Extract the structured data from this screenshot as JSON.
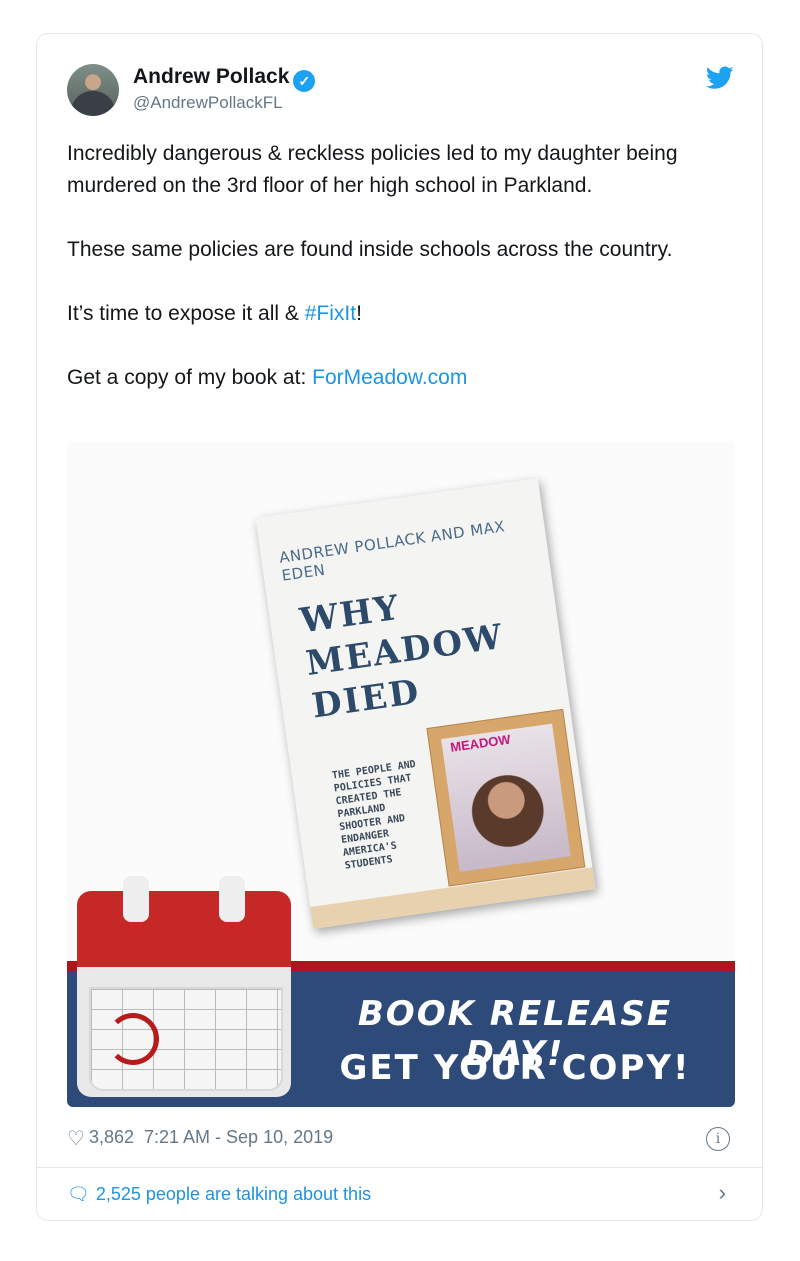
{
  "author": {
    "name": "Andrew Pollack",
    "handle": "@AndrewPollackFL"
  },
  "tweet": {
    "line1": "Incredibly dangerous & reckless policies led to my daughter being murdered on the 3rd floor of her high school in Parkland.",
    "line2": "These same policies are found inside schools across the country.",
    "line3_prefix": "It’s time to expose it all & ",
    "hashtag": "#FixIt",
    "line3_suffix": "!",
    "line4_prefix": "Get a copy of my book at: ",
    "link": "ForMeadow.com"
  },
  "media": {
    "book_authors": "ANDREW POLLACK AND MAX EDEN",
    "book_title_1": "WHY",
    "book_title_2": "MEADOW",
    "book_title_3": "DIED",
    "book_subtitle": "THE PEOPLE AND POLICIES THAT CREATED THE PARKLAND SHOOTER AND ENDANGER AMERICA'S STUDENTS",
    "frame_label": "MEADOW",
    "promo_line1": "BOOK RELEASE DAY!",
    "promo_line2": "GET YOUR COPY!"
  },
  "footer": {
    "likes": "3,862",
    "timestamp": "7:21 AM - Sep 10, 2019",
    "talking": "2,525 people are talking about this"
  },
  "icons": {
    "verified": "verified-badge-icon",
    "twitter": "twitter-bird-icon",
    "like": "heart-icon",
    "info": "info-icon",
    "reply": "speech-bubble-icon",
    "chevron": "chevron-right-icon"
  },
  "colors": {
    "brand": "#1da1f2",
    "link": "#1b95e0",
    "muted": "#657786",
    "banner": "#2d4a79",
    "banner_stripe": "#a8181c"
  }
}
